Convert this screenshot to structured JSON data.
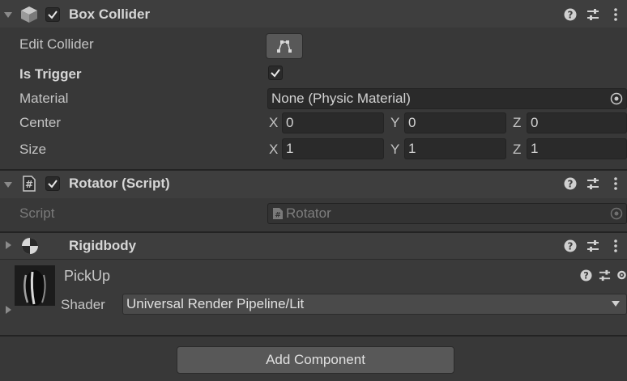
{
  "box_collider": {
    "title": "Box Collider",
    "edit_collider_label": "Edit Collider",
    "is_trigger_label": "Is Trigger",
    "material_label": "Material",
    "material_value": "None (Physic Material)",
    "center_label": "Center",
    "center": {
      "x_axis": "X",
      "x": "0",
      "y_axis": "Y",
      "y": "0",
      "z_axis": "Z",
      "z": "0"
    },
    "size_label": "Size",
    "size": {
      "x_axis": "X",
      "x": "1",
      "y_axis": "Y",
      "y": "1",
      "z_axis": "Z",
      "z": "1"
    }
  },
  "rotator": {
    "title": "Rotator (Script)",
    "script_label": "Script",
    "script_value": "Rotator"
  },
  "rigidbody": {
    "title": "Rigidbody"
  },
  "material": {
    "name": "PickUp",
    "shader_label": "Shader",
    "shader_value": "Universal Render Pipeline/Lit"
  },
  "add_component_label": "Add Component",
  "icons": [
    "cube-icon",
    "script-icon",
    "rigidbody-icon",
    "help-icon",
    "presets-icon",
    "kebab-menu-icon",
    "edit-collider-icon",
    "object-picker-icon",
    "dropdown-arrow-icon"
  ],
  "colors": {
    "background": "#383838",
    "header": "#3e3e3e",
    "field": "#2a2a2a",
    "button": "#585858"
  }
}
